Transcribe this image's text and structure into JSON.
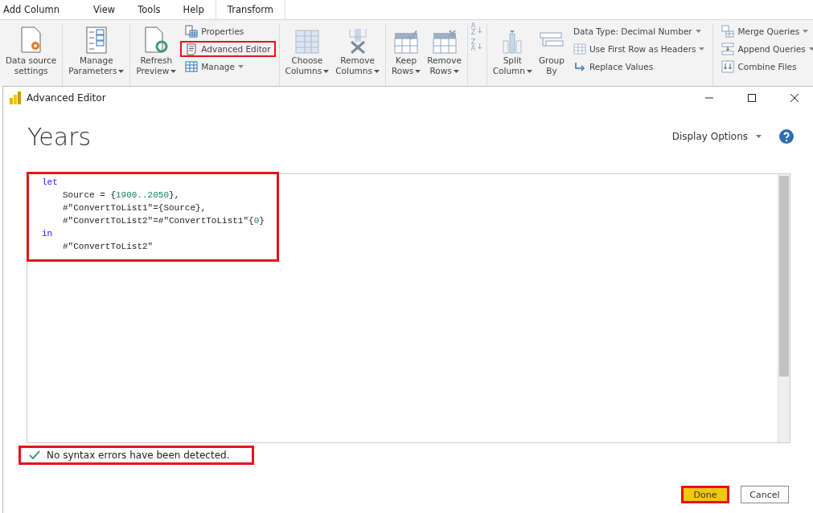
{
  "ribbon": {
    "tabs": [
      {
        "label": "Add Column",
        "selected": false
      },
      {
        "label": "View",
        "selected": false
      },
      {
        "label": "Tools",
        "selected": false
      },
      {
        "label": "Help",
        "selected": false
      },
      {
        "label": "Transform",
        "selected": true
      }
    ],
    "groups": [
      {
        "items": [
          {
            "kind": "large",
            "lines": [
              "Data source",
              "settings"
            ],
            "dropdown": false
          }
        ]
      },
      {
        "items": [
          {
            "kind": "large",
            "lines": [
              "Manage",
              "Parameters"
            ],
            "dropdown": true
          }
        ]
      },
      {
        "items": [
          {
            "kind": "large",
            "lines": [
              "Refresh",
              "Preview"
            ],
            "dropdown": true
          },
          {
            "kind": "stack",
            "entries": [
              {
                "label": "Properties",
                "dropdown": false,
                "highlighted": false
              },
              {
                "label": "Advanced Editor",
                "dropdown": false,
                "highlighted": true
              },
              {
                "label": "Manage",
                "dropdown": true,
                "highlighted": false
              }
            ]
          }
        ]
      },
      {
        "items": [
          {
            "kind": "large",
            "lines": [
              "Choose",
              "Columns"
            ],
            "dropdown": true
          },
          {
            "kind": "large",
            "lines": [
              "Remove",
              "Columns"
            ],
            "dropdown": true
          }
        ]
      },
      {
        "items": [
          {
            "kind": "large",
            "lines": [
              "Keep",
              "Rows"
            ],
            "dropdown": true
          },
          {
            "kind": "large",
            "lines": [
              "Remove",
              "Rows"
            ],
            "dropdown": true
          }
        ]
      },
      {
        "items": [
          {
            "kind": "sort",
            "entries": [
              {
                "top": "A",
                "bottom": "Z",
                "arrow": "↓"
              },
              {
                "top": "Z",
                "bottom": "A",
                "arrow": "↓"
              }
            ]
          }
        ]
      },
      {
        "items": [
          {
            "kind": "large",
            "lines": [
              "Split",
              "Column"
            ],
            "dropdown": true
          },
          {
            "kind": "large",
            "lines": [
              "Group",
              "By"
            ],
            "dropdown": false
          },
          {
            "kind": "stack",
            "entries": [
              {
                "label": "Data Type: Decimal Number",
                "dropdown": true,
                "highlighted": false
              },
              {
                "label": "Use First Row as Headers",
                "dropdown": true,
                "highlighted": false
              },
              {
                "label": "Replace Values",
                "dropdown": false,
                "highlighted": false
              }
            ]
          }
        ]
      },
      {
        "items": [
          {
            "kind": "stack",
            "entries": [
              {
                "label": "Merge Queries",
                "dropdown": true,
                "highlighted": false
              },
              {
                "label": "Append Queries",
                "dropdown": true,
                "highlighted": false
              },
              {
                "label": "Combine Files",
                "dropdown": false,
                "highlighted": false
              }
            ]
          }
        ]
      }
    ]
  },
  "dialog": {
    "title": "Advanced Editor",
    "query_name": "Years",
    "display_options": "Display Options",
    "editor": {
      "highlighted": true,
      "lines": [
        {
          "indented": false,
          "tokens": [
            {
              "kind": "keyword",
              "text": "let"
            }
          ]
        },
        {
          "indented": true,
          "tokens": [
            {
              "kind": "plain",
              "text": "Source = {"
            },
            {
              "kind": "number",
              "text": "1900..2050"
            },
            {
              "kind": "plain",
              "text": "},"
            }
          ]
        },
        {
          "indented": true,
          "tokens": [
            {
              "kind": "plain",
              "text": "#\"ConvertToList1\"={Source},"
            }
          ]
        },
        {
          "indented": true,
          "tokens": [
            {
              "kind": "plain",
              "text": "#\"ConvertToList2\"=#\"ConvertToList1\"{"
            },
            {
              "kind": "number",
              "text": "0"
            },
            {
              "kind": "plain",
              "text": "}"
            }
          ]
        },
        {
          "indented": false,
          "tokens": [
            {
              "kind": "keyword",
              "text": "in"
            }
          ]
        },
        {
          "indented": true,
          "tokens": [
            {
              "kind": "plain",
              "text": "#\"ConvertToList2\""
            }
          ]
        }
      ]
    },
    "status": {
      "text": "No syntax errors have been detected.",
      "highlighted": true
    },
    "buttons": [
      {
        "label": "Done",
        "primary": true,
        "highlighted": true
      },
      {
        "label": "Cancel",
        "primary": false,
        "highlighted": false
      }
    ]
  }
}
